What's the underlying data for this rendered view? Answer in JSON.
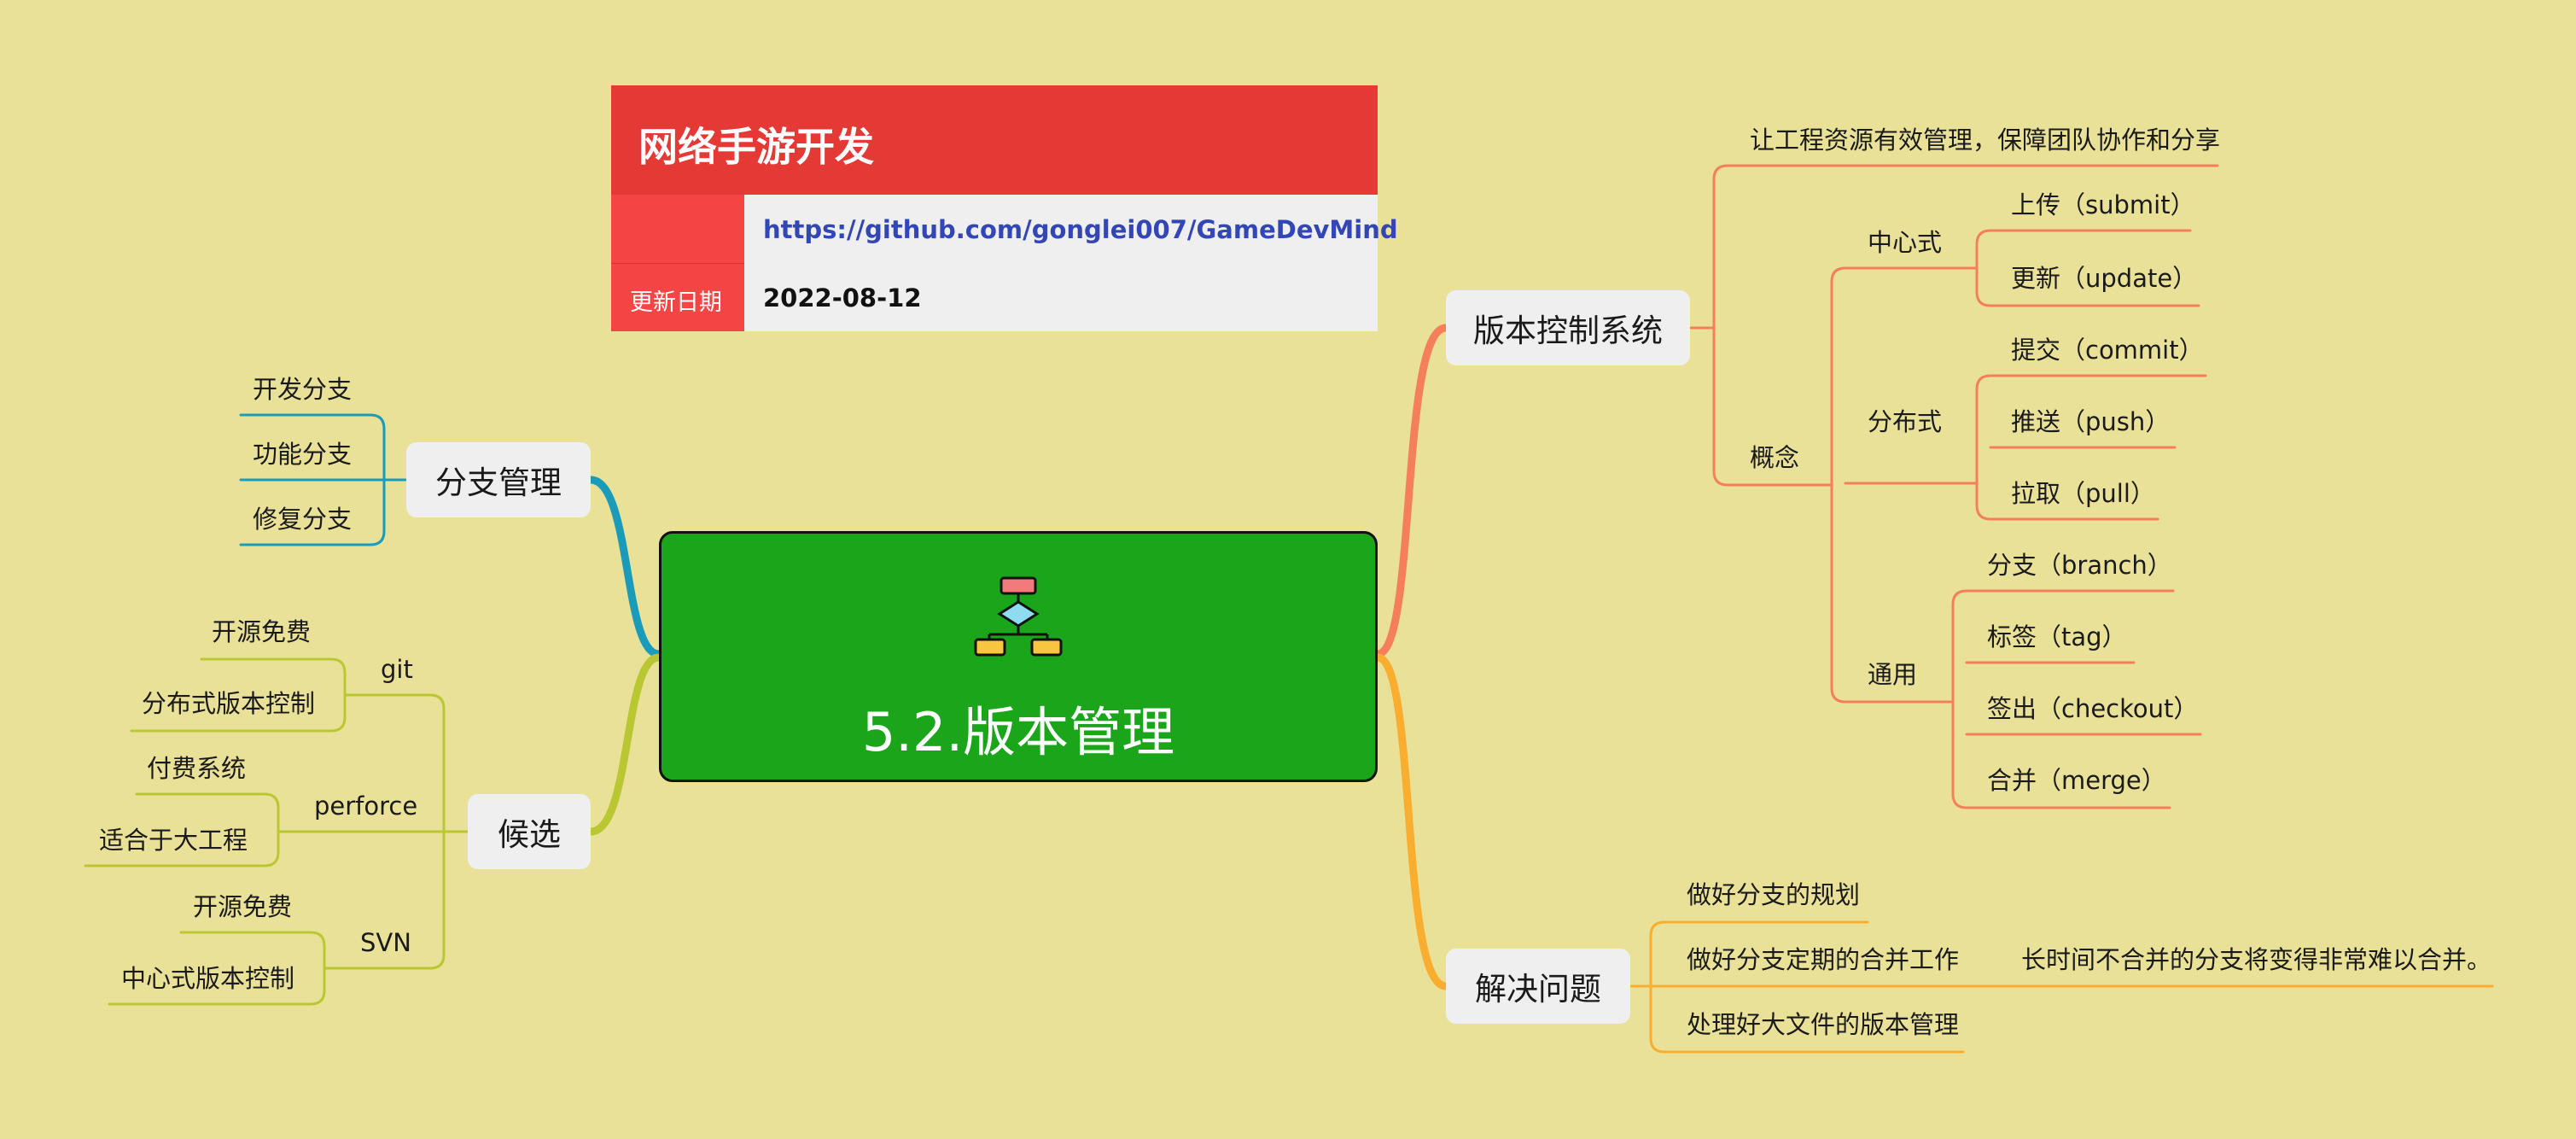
{
  "colors": {
    "background": "#eae199",
    "central_fill": "#1aa51a",
    "version_control_branch": "#f57f5b",
    "problems_branch": "#f9ae2f",
    "branch_mgmt_branch": "#1b9bba",
    "candidates_branch": "#b9c832",
    "banner_red": "#e53935",
    "link_blue": "#3346b5"
  },
  "banner": {
    "title": "网络手游开发",
    "link": "https://github.com/gonglei007/GameDevMind",
    "date_label": "更新日期",
    "date": "2022-08-12"
  },
  "central": {
    "title": "5.2.版本管理",
    "icon": "flowchart-icon"
  },
  "version_control": {
    "label": "版本控制系统",
    "goal": "让工程资源有效管理，保障团队协作和分享",
    "concept": "概念",
    "centralized": {
      "label": "中心式",
      "items": [
        "上传（submit）",
        "更新（update）"
      ]
    },
    "distributed": {
      "label": "分布式",
      "items": [
        "提交（commit）",
        "推送（push）",
        "拉取（pull）"
      ]
    },
    "common": {
      "label": "通用",
      "items": [
        "分支（branch）",
        "标签（tag）",
        "签出（checkout）",
        "合并（merge）"
      ]
    }
  },
  "problems": {
    "label": "解决问题",
    "items": [
      "做好分支的规划",
      "做好分支定期的合并工作",
      "处理好大文件的版本管理"
    ],
    "merge_note": "长时间不合并的分支将变得非常难以合并。"
  },
  "branch_mgmt": {
    "label": "分支管理",
    "items": [
      "开发分支",
      "功能分支",
      "修复分支"
    ]
  },
  "candidates": {
    "label": "候选",
    "git": {
      "label": "git",
      "items": [
        "开源免费",
        "分布式版本控制"
      ]
    },
    "perforce": {
      "label": "perforce",
      "items": [
        "付费系统",
        "适合于大工程"
      ]
    },
    "svn": {
      "label": "SVN",
      "items": [
        "开源免费",
        "中心式版本控制"
      ]
    }
  }
}
